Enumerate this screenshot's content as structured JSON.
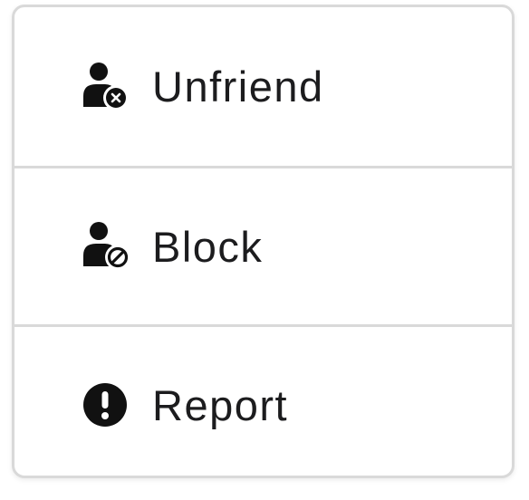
{
  "menu": {
    "items": [
      {
        "label": "Unfriend",
        "icon": "user-remove-icon"
      },
      {
        "label": "Block",
        "icon": "user-block-icon"
      },
      {
        "label": "Report",
        "icon": "exclamation-circle-icon"
      }
    ]
  },
  "colors": {
    "text": "#1c1c1e",
    "icon": "#111111",
    "border": "#d9d9d9",
    "background": "#ffffff"
  }
}
